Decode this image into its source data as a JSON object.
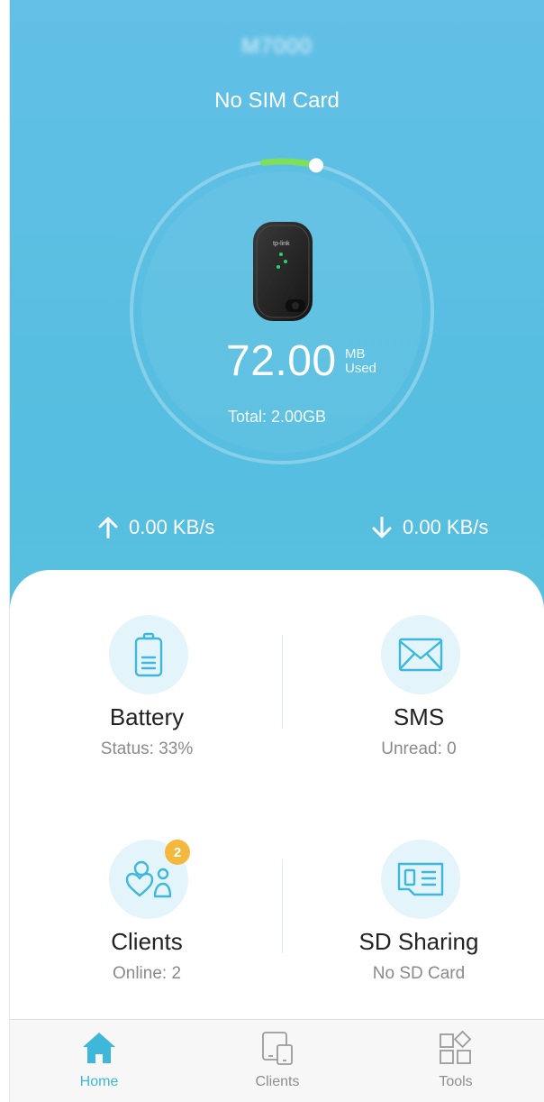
{
  "header": {
    "device_name": "M7000",
    "sim_status": "No SIM Card"
  },
  "usage": {
    "used_value": "72.00",
    "used_unit": "MB",
    "used_label": "Used",
    "total": "Total: 2.00GB",
    "used_fraction": 0.035
  },
  "speed": {
    "upload": "0.00 KB/s",
    "download": "0.00 KB/s"
  },
  "tiles": [
    {
      "title": "Battery",
      "subtitle": "Status: 33%",
      "icon": "battery-icon"
    },
    {
      "title": "SMS",
      "subtitle": "Unread: 0",
      "icon": "envelope-icon"
    },
    {
      "title": "Clients",
      "subtitle": "Online: 2",
      "icon": "clients-icon",
      "badge": "2"
    },
    {
      "title": "SD Sharing",
      "subtitle": "No SD Card",
      "icon": "sd-card-icon"
    }
  ],
  "tabbar": [
    {
      "label": "Home",
      "icon": "home-icon",
      "active": true
    },
    {
      "label": "Clients",
      "icon": "devices-icon",
      "active": false
    },
    {
      "label": "Tools",
      "icon": "tools-icon",
      "active": false
    }
  ],
  "colors": {
    "accent": "#3fb7da",
    "gauge_fill": "#7ee05a",
    "badge": "#f4b83c"
  }
}
